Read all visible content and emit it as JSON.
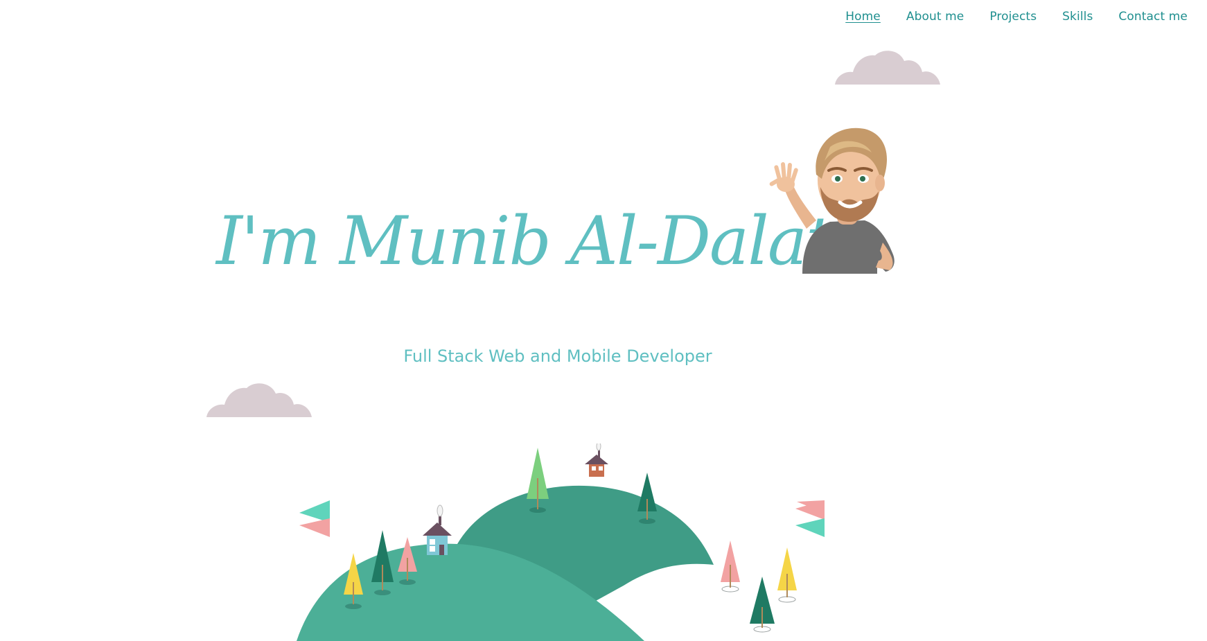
{
  "nav": {
    "items": [
      {
        "label": "Home",
        "active": true
      },
      {
        "label": "About me",
        "active": false
      },
      {
        "label": "Projects",
        "active": false
      },
      {
        "label": "Skills",
        "active": false
      },
      {
        "label": "Contact me",
        "active": false
      }
    ]
  },
  "hero": {
    "title": "I'm Munib Al-Dalati",
    "subtitle": "Full Stack Web and Mobile Developer"
  },
  "colors": {
    "accent": "#5fbfc1",
    "nav_text": "#1f8f8f",
    "hill_dark": "#3f9c86",
    "hill_light": "#4caf97",
    "cloud": "#d9cdd2",
    "flag_teal": "#5fd4bb",
    "flag_pink": "#f2a2a2",
    "tree_yellow": "#f5d547",
    "tree_green": "#1f7a63",
    "tree_pink": "#f2a2a2",
    "tree_lightgreen": "#7ccf7e"
  },
  "icons": {
    "avatar": "waving-avatar-icon",
    "cloud": "cloud-icon",
    "flag": "flag-icon",
    "tree": "tree-icon",
    "house": "house-icon"
  }
}
